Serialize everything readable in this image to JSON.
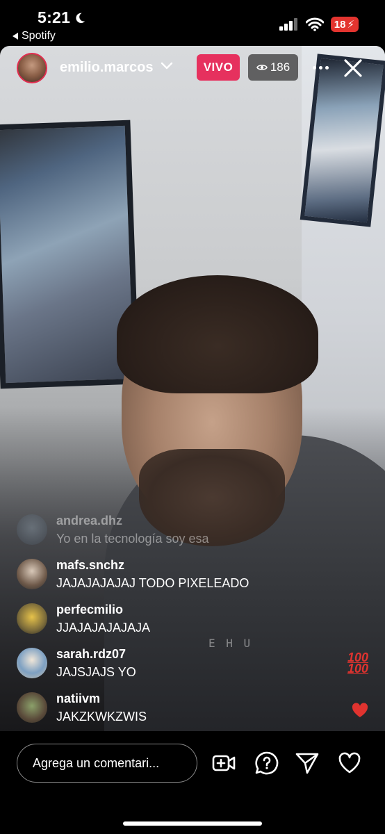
{
  "status_bar": {
    "time": "5:21",
    "back_app": "Spotify",
    "battery": "18"
  },
  "header": {
    "host_name": "emilio.marcos",
    "live_label": "VIVO",
    "viewer_count": "186"
  },
  "video": {
    "shirt_text": "E   H   U"
  },
  "comments": [
    {
      "user": "andrea.dhz",
      "text": "Yo en la tecnología soy esa"
    },
    {
      "user": "mafs.snchz",
      "text": "JAJAJAJAJAJ TODO PIXELEADO"
    },
    {
      "user": "perfecmilio",
      "text": "JJAJAJAJAJAJA"
    },
    {
      "user": "sarah.rdz07",
      "text": "JAJSJAJS YO"
    },
    {
      "user": "natiivm",
      "text": "JAKZKWKZWIS"
    }
  ],
  "reactions": {
    "hundred": "100\n100"
  },
  "bottom_bar": {
    "comment_placeholder": "Agrega un comentari..."
  },
  "colors": {
    "live_red": "#e6315e",
    "heart_red": "#e0332f",
    "battery_red": "#e3342f"
  },
  "icons": [
    "moon-icon",
    "signal-icon",
    "wifi-icon",
    "battery-icon",
    "chevron-down-icon",
    "eye-icon",
    "more-icon",
    "close-icon",
    "add-video-icon",
    "question-icon",
    "send-icon",
    "heart-icon"
  ]
}
